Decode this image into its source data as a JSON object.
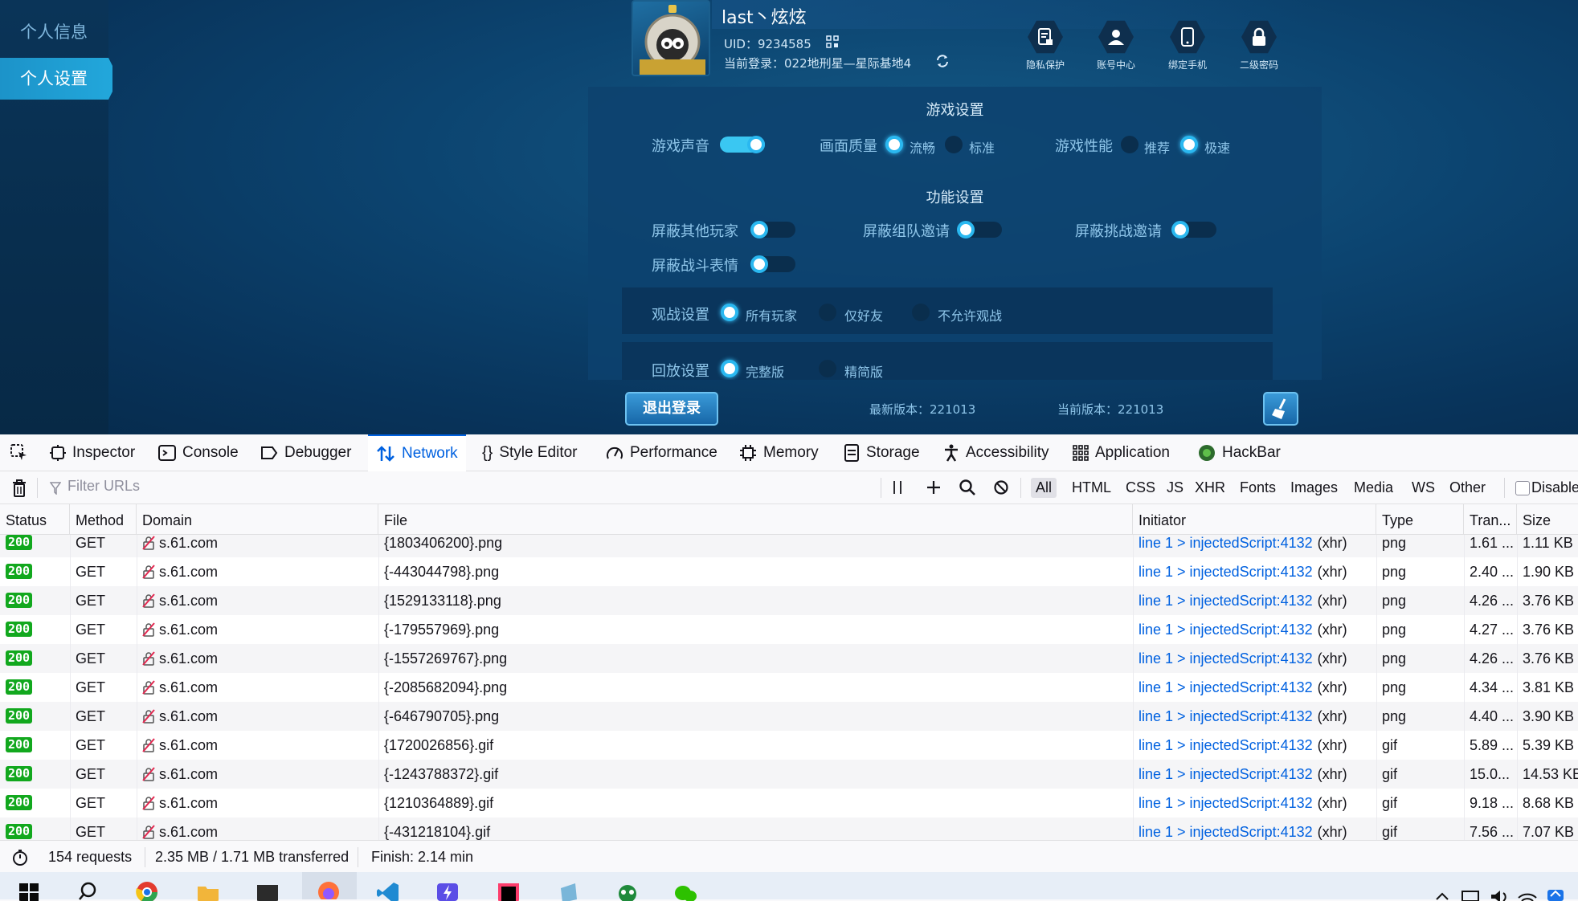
{
  "game": {
    "sidebar": [
      "个人信息",
      "个人设置"
    ],
    "username": "last丶炫炫",
    "uid": "UID：9234585",
    "login": "当前登录：022地刑星—星际基地4",
    "top_icons": [
      "隐私保护",
      "账号中心",
      "绑定手机",
      "二级密码"
    ],
    "section_game": "游戏设置",
    "sound_label": "游戏声音",
    "quality_label": "画面质量",
    "quality_opt1": "流畅",
    "quality_opt2": "标准",
    "perf_label": "游戏性能",
    "perf_opt1": "推荐",
    "perf_opt2": "极速",
    "section_func": "功能设置",
    "block_players": "屏蔽其他玩家",
    "block_team": "屏蔽组队邀请",
    "block_challenge": "屏蔽挑战邀请",
    "block_emote": "屏蔽战斗表情",
    "watch_label": "观战设置",
    "watch_opt1": "所有玩家",
    "watch_opt2": "仅好友",
    "watch_opt3": "不允许观战",
    "replay_label": "回放设置",
    "replay_opt1": "完整版",
    "replay_opt2": "精简版",
    "logout": "退出登录",
    "latest_version": "最新版本：221013",
    "current_version": "当前版本：221013"
  },
  "devtools": {
    "tabs": [
      "Inspector",
      "Console",
      "Debugger",
      "Network",
      "Style Editor",
      "Performance",
      "Memory",
      "Storage",
      "Accessibility",
      "Application",
      "HackBar"
    ],
    "filter_placeholder": "Filter URLs",
    "type_filters": [
      "All",
      "HTML",
      "CSS",
      "JS",
      "XHR",
      "Fonts",
      "Images",
      "Media",
      "WS",
      "Other"
    ],
    "disable_label": "Disable",
    "columns": [
      "Status",
      "Method",
      "Domain",
      "File",
      "Initiator",
      "Type",
      "Tran...",
      "Size"
    ],
    "rows": [
      {
        "status": "200",
        "method": "GET",
        "domain": "s.61.com",
        "file": "{1803406200}.png",
        "initiator": "line 1 > injectedScript:4132",
        "xhr": "(xhr)",
        "type": "png",
        "transferred": "1.61 ...",
        "size": "1.11 KB"
      },
      {
        "status": "200",
        "method": "GET",
        "domain": "s.61.com",
        "file": "{-443044798}.png",
        "initiator": "line 1 > injectedScript:4132",
        "xhr": "(xhr)",
        "type": "png",
        "transferred": "2.40 ...",
        "size": "1.90 KB"
      },
      {
        "status": "200",
        "method": "GET",
        "domain": "s.61.com",
        "file": "{1529133118}.png",
        "initiator": "line 1 > injectedScript:4132",
        "xhr": "(xhr)",
        "type": "png",
        "transferred": "4.26 ...",
        "size": "3.76 KB"
      },
      {
        "status": "200",
        "method": "GET",
        "domain": "s.61.com",
        "file": "{-179557969}.png",
        "initiator": "line 1 > injectedScript:4132",
        "xhr": "(xhr)",
        "type": "png",
        "transferred": "4.27 ...",
        "size": "3.76 KB"
      },
      {
        "status": "200",
        "method": "GET",
        "domain": "s.61.com",
        "file": "{-1557269767}.png",
        "initiator": "line 1 > injectedScript:4132",
        "xhr": "(xhr)",
        "type": "png",
        "transferred": "4.26 ...",
        "size": "3.76 KB"
      },
      {
        "status": "200",
        "method": "GET",
        "domain": "s.61.com",
        "file": "{-2085682094}.png",
        "initiator": "line 1 > injectedScript:4132",
        "xhr": "(xhr)",
        "type": "png",
        "transferred": "4.34 ...",
        "size": "3.81 KB"
      },
      {
        "status": "200",
        "method": "GET",
        "domain": "s.61.com",
        "file": "{-646790705}.png",
        "initiator": "line 1 > injectedScript:4132",
        "xhr": "(xhr)",
        "type": "png",
        "transferred": "4.40 ...",
        "size": "3.90 KB"
      },
      {
        "status": "200",
        "method": "GET",
        "domain": "s.61.com",
        "file": "{1720026856}.gif",
        "initiator": "line 1 > injectedScript:4132",
        "xhr": "(xhr)",
        "type": "gif",
        "transferred": "5.89 ...",
        "size": "5.39 KB"
      },
      {
        "status": "200",
        "method": "GET",
        "domain": "s.61.com",
        "file": "{-1243788372}.gif",
        "initiator": "line 1 > injectedScript:4132",
        "xhr": "(xhr)",
        "type": "gif",
        "transferred": "15.0...",
        "size": "14.53 KB"
      },
      {
        "status": "200",
        "method": "GET",
        "domain": "s.61.com",
        "file": "{1210364889}.gif",
        "initiator": "line 1 > injectedScript:4132",
        "xhr": "(xhr)",
        "type": "gif",
        "transferred": "9.18 ...",
        "size": "8.68 KB"
      },
      {
        "status": "200",
        "method": "GET",
        "domain": "s.61.com",
        "file": "{-431218104}.gif",
        "initiator": "line 1 > injectedScript:4132",
        "xhr": "(xhr)",
        "type": "gif",
        "transferred": "7.56 ...",
        "size": "7.07 KB"
      }
    ],
    "summary": {
      "requests": "154 requests",
      "transfer": "2.35 MB / 1.71 MB transferred",
      "finish": "Finish: 2.14 min"
    }
  },
  "colors": {
    "accent": "#0061e0",
    "status_ok": "#12a81e",
    "game_bg": "#0c4470"
  }
}
